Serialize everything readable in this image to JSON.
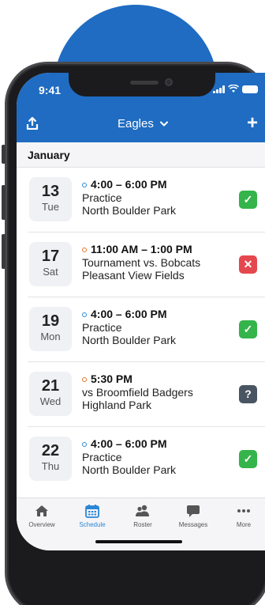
{
  "status_bar": {
    "time": "9:41"
  },
  "app_bar": {
    "title": "Eagles",
    "chevron": "⌄",
    "add_label": "+"
  },
  "month": "January",
  "events": [
    {
      "day": "13",
      "weekday": "Tue",
      "time": "4:00 – 6:00 PM",
      "title": "Practice",
      "location": "North Boulder Park",
      "dot": "blue",
      "rsvp": "yes",
      "rsvp_glyph": "✓"
    },
    {
      "day": "17",
      "weekday": "Sat",
      "time": "11:00 AM – 1:00 PM",
      "title": "Tournament vs. Bobcats",
      "location": "Pleasant View Fields",
      "dot": "orange",
      "rsvp": "no",
      "rsvp_glyph": "✕"
    },
    {
      "day": "19",
      "weekday": "Mon",
      "time": "4:00 – 6:00 PM",
      "title": "Practice",
      "location": "North Boulder Park",
      "dot": "blue",
      "rsvp": "yes",
      "rsvp_glyph": "✓"
    },
    {
      "day": "21",
      "weekday": "Wed",
      "time": "5:30 PM",
      "title": "vs Broomfield Badgers",
      "location": "Highland Park",
      "dot": "orange",
      "rsvp": "maybe",
      "rsvp_glyph": "?"
    },
    {
      "day": "22",
      "weekday": "Thu",
      "time": "4:00 – 6:00 PM",
      "title": "Practice",
      "location": "North Boulder Park",
      "dot": "blue",
      "rsvp": "yes",
      "rsvp_glyph": "✓"
    }
  ],
  "tabs": [
    {
      "label": "Overview",
      "icon": "home-icon"
    },
    {
      "label": "Schedule",
      "icon": "calendar-icon",
      "active": true
    },
    {
      "label": "Roster",
      "icon": "roster-icon"
    },
    {
      "label": "Messages",
      "icon": "chat-bubble-icon"
    },
    {
      "label": "More",
      "icon": "more-dots-icon"
    }
  ],
  "colors": {
    "brand": "#1f6cc2",
    "accept": "#34b44a",
    "decline": "#e5474f",
    "maybe": "#4a5563",
    "active_tab": "#2a86d6"
  }
}
